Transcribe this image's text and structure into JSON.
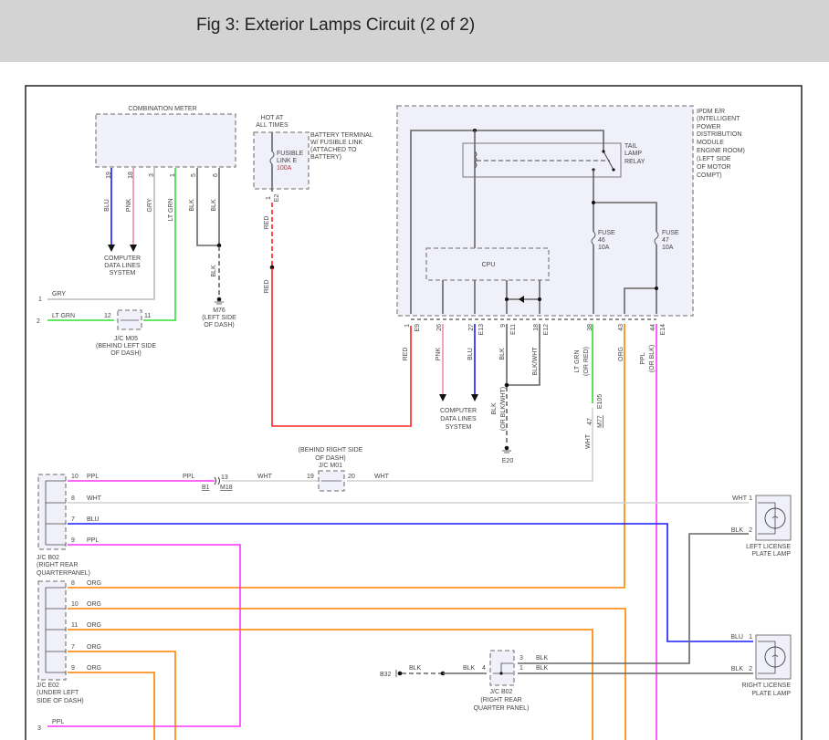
{
  "header": {
    "title": "Fig 3: Exterior Lamps Circuit (2 of 2)"
  },
  "wire_colors": {
    "RED": "#ff2222",
    "BLU": "#1a1aff",
    "PNK": "#f08aa0",
    "GRY": "#bbbbbb",
    "LT GRN": "#33dd33",
    "BLK": "#666666",
    "ORG": "#ff8000",
    "PPL": "#ff33ff",
    "WHT": "#d0d0d0"
  },
  "components": {
    "combination_meter": "COMBINATION METER",
    "hot_at_all_times": [
      "HOT AT",
      "ALL TIMES"
    ],
    "battery_terminal": [
      "BATTERY TERMINAL",
      "W/ FUSIBLE LINK",
      "(ATTACHED TO",
      "BATTERY)"
    ],
    "fusible_link": [
      "FUSIBLE",
      "LINK E",
      "100A"
    ],
    "ipdm": [
      "IPDM E/R",
      "(INTELLIGENT",
      "POWER",
      "DISTRIBUTION",
      "MODULE",
      "ENGINE ROOM)",
      "(LEFT SIDE",
      "OF MOTOR",
      "COMPT)"
    ],
    "tail_lamp_relay": [
      "TAIL",
      "LAMP",
      "RELAY"
    ],
    "cpu": "CPU",
    "fuse46": [
      "FUSE",
      "46",
      "10A"
    ],
    "fuse47": [
      "FUSE",
      "47",
      "10A"
    ],
    "data_lines": [
      "COMPUTER",
      "DATA LINES",
      "SYSTEM"
    ],
    "jc_m05": [
      "J/C M05",
      "(BEHIND LEFT SIDE",
      "OF DASH)"
    ],
    "m76": [
      "M76",
      "(LEFT SIDE",
      "OF DASH)"
    ],
    "e20": "E20",
    "jc_m01": [
      "(BEHIND RIGHT SIDE",
      "OF DASH)",
      "J/C M01"
    ],
    "jc_b02_left": [
      "J/C B02",
      "(RIGHT REAR",
      "QUARTERPANEL)"
    ],
    "jc_e02": [
      "J/C E02",
      "(UNDER LEFT",
      "SIDE OF DASH)"
    ],
    "jc_b02_right": [
      "J/C B02",
      "(RIGHT REAR",
      "QUARTER PANEL)"
    ],
    "left_lamp": [
      "LEFT LICENSE",
      "PLATE LAMP"
    ],
    "right_lamp": [
      "RIGHT LICENSE",
      "PLATE LAMP"
    ],
    "b32": "B32",
    "b1": "B1",
    "m18": "M18",
    "e105": "E105",
    "m77": "M77",
    "e2": "E2"
  },
  "meter_pins": [
    {
      "pin": "19",
      "wire": "BLU"
    },
    {
      "pin": "18",
      "wire": "PNK"
    },
    {
      "pin": "3",
      "wire": "GRY"
    },
    {
      "pin": "1",
      "wire": "LT GRN"
    },
    {
      "pin": "5",
      "wire": "BLK"
    },
    {
      "pin": "6",
      "wire": "BLK"
    }
  ],
  "ipdm_pins": [
    {
      "pin": "1",
      "conn": "E9",
      "wire": "RED"
    },
    {
      "pin": "26",
      "conn": "",
      "wire": "PNK"
    },
    {
      "pin": "27",
      "conn": "E13",
      "wire": "BLU"
    },
    {
      "pin": "9",
      "conn": "E11",
      "wire": "BLK"
    },
    {
      "pin": "18",
      "conn": "E12",
      "wire": "BLK/WHT"
    },
    {
      "pin": "38",
      "conn": "",
      "wire": "LT GRN",
      "alt": "(OR RED)"
    },
    {
      "pin": "43",
      "conn": "",
      "wire": "ORG"
    },
    {
      "pin": "44",
      "conn": "E14",
      "wire": "PPL",
      "alt": "(OR BLK)"
    }
  ],
  "misc_labels": {
    "gry_1": "1",
    "gry_label": "GRY",
    "ltgrn_2": "2",
    "ltgrn_label": "LT GRN",
    "m05_12": "12",
    "m05_11": "11",
    "m76_blk": "BLK",
    "red1": "RED",
    "red2": "RED",
    "fl_pin": "1",
    "e20_blk": "BLK",
    "e20_alt": "(OR BLK/WHT)",
    "e105_pin": "47",
    "wht_up": "WHT",
    "m18_ppl": "PPL",
    "m18_13": "13",
    "m18_wht": "WHT",
    "m01_19": "19",
    "m01_20": "20",
    "m01_wht": "WHT",
    "p3": "3",
    "p3_ppl": "PPL"
  },
  "b02_left_rows": [
    {
      "pin": "10",
      "wire": "PPL"
    },
    {
      "pin": "8",
      "wire": "WHT"
    },
    {
      "pin": "7",
      "wire": "BLU"
    },
    {
      "pin": "9",
      "wire": "PPL"
    }
  ],
  "e02_rows": [
    {
      "pin": "8",
      "wire": "ORG"
    },
    {
      "pin": "10",
      "wire": "ORG"
    },
    {
      "pin": "11",
      "wire": "ORG"
    },
    {
      "pin": "7",
      "wire": "ORG"
    },
    {
      "pin": "9",
      "wire": "ORG"
    }
  ],
  "lamps": {
    "left": [
      {
        "pin": "1",
        "wire": "WHT"
      },
      {
        "pin": "2",
        "wire": "BLK"
      }
    ],
    "right": [
      {
        "pin": "1",
        "wire": "BLU"
      },
      {
        "pin": "2",
        "wire": "BLK"
      }
    ]
  },
  "b02_right": {
    "in_pin": "4",
    "in_wire": "BLK",
    "ground_wire": "BLK",
    "out": [
      {
        "pin": "3",
        "wire": "BLK"
      },
      {
        "pin": "1",
        "wire": "BLK"
      }
    ]
  }
}
